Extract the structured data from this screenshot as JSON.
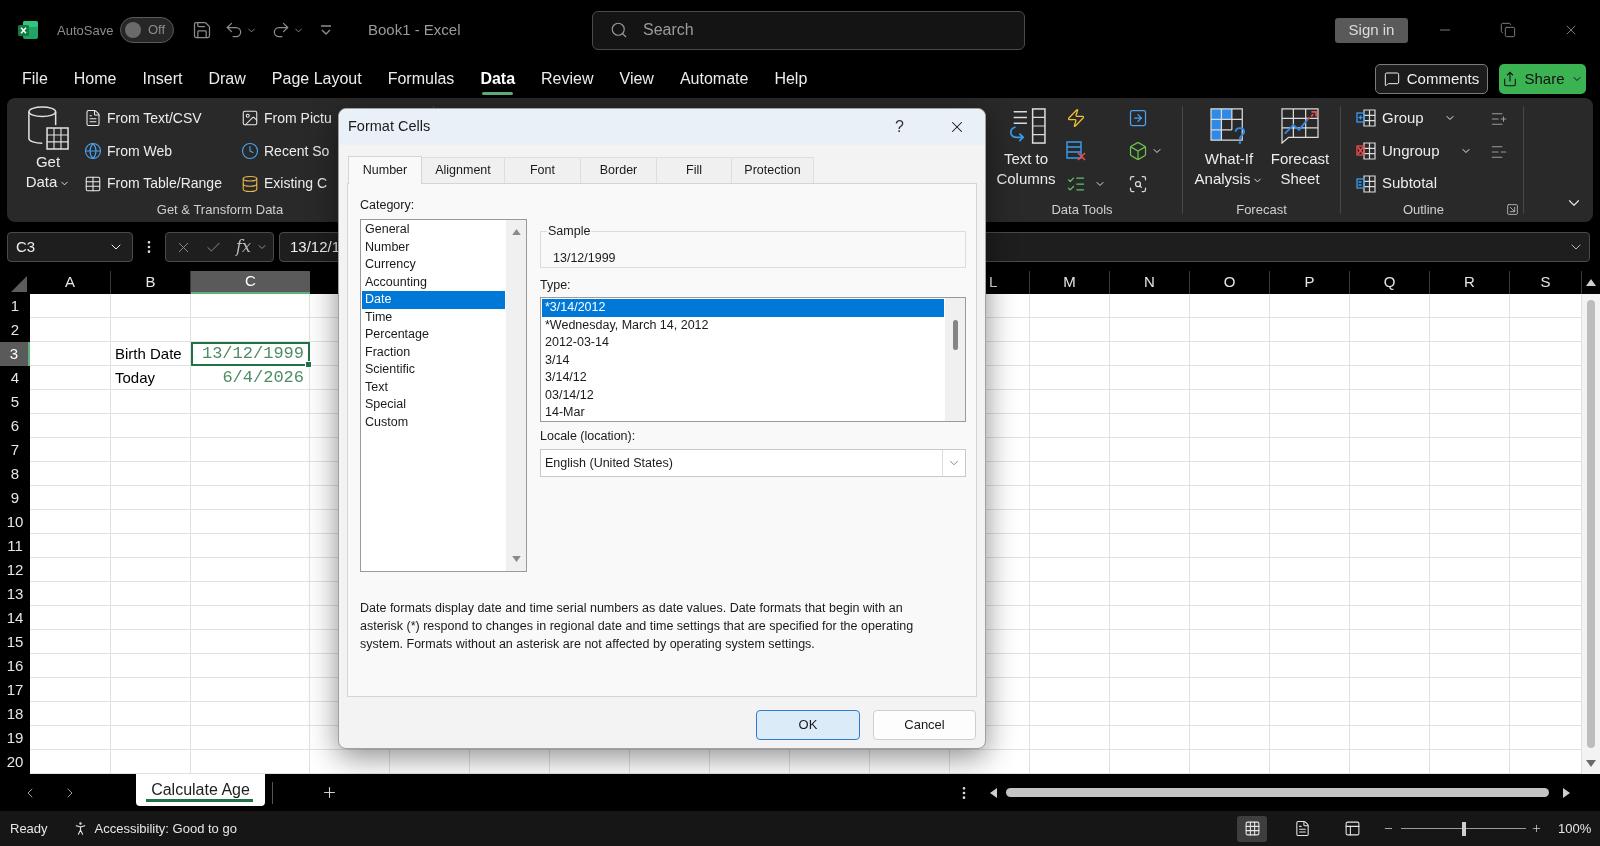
{
  "title_bar": {
    "autosave": "AutoSave",
    "autosave_toggle": {
      "label": "Off",
      "on": false
    },
    "document": "Book1 - Excel",
    "search": {
      "placeholder": "Search"
    },
    "sign_in": "Sign in"
  },
  "menu": {
    "tabs": [
      {
        "label": "File",
        "selected": false
      },
      {
        "label": "Home",
        "selected": false
      },
      {
        "label": "Insert",
        "selected": false
      },
      {
        "label": "Draw",
        "selected": false
      },
      {
        "label": "Page Layout",
        "selected": false
      },
      {
        "label": "Formulas",
        "selected": false
      },
      {
        "label": "Data",
        "selected": true
      },
      {
        "label": "Review",
        "selected": false
      },
      {
        "label": "View",
        "selected": false
      },
      {
        "label": "Automate",
        "selected": false
      },
      {
        "label": "Help",
        "selected": false
      }
    ],
    "comments": "Comments",
    "share": "Share"
  },
  "ribbon": {
    "get_transform": {
      "label": "Get & Transform Data",
      "get_data": "Get Data",
      "sources": [
        "From Text/CSV",
        "From Web",
        "From Table/Range"
      ],
      "more_sources": [
        "From Pictu",
        "Recent So",
        "Existing C"
      ]
    },
    "data_tools": {
      "label": "Data Tools",
      "text_to_columns": "Text to Columns"
    },
    "forecast": {
      "label": "Forecast",
      "what_if": "What-If Analysis",
      "forecast_sheet": "Forecast Sheet"
    },
    "outline": {
      "label": "Outline",
      "items": [
        "Group",
        "Ungroup",
        "Subtotal"
      ]
    }
  },
  "formula_bar": {
    "name_box": "C3",
    "function": "fx",
    "value": "13/12/1"
  },
  "sheet": {
    "columns": [
      {
        "label": "A",
        "selected": false
      },
      {
        "label": "B",
        "selected": false
      },
      {
        "label": "C",
        "selected": true
      },
      {
        "label": "L",
        "selected": false
      },
      {
        "label": "M",
        "selected": false
      },
      {
        "label": "N",
        "selected": false
      },
      {
        "label": "O",
        "selected": false
      },
      {
        "label": "P",
        "selected": false
      },
      {
        "label": "Q",
        "selected": false
      },
      {
        "label": "R",
        "selected": false
      },
      {
        "label": "S",
        "selected": false
      }
    ],
    "rows": [
      {
        "label": "1",
        "selected": false
      },
      {
        "label": "2",
        "selected": false
      },
      {
        "label": "3",
        "selected": true,
        "column_b": "Birth Date",
        "column_c": {
          "value": "13/12/1999",
          "selected": true
        }
      },
      {
        "label": "4",
        "selected": false,
        "column_b": "Today",
        "column_c": {
          "value": "6/4/2026",
          "selected": false
        }
      },
      {
        "label": "5",
        "selected": false
      },
      {
        "label": "6",
        "selected": false
      },
      {
        "label": "7",
        "selected": false
      },
      {
        "label": "8",
        "selected": false
      },
      {
        "label": "9",
        "selected": false
      },
      {
        "label": "10",
        "selected": false
      },
      {
        "label": "11",
        "selected": false
      },
      {
        "label": "12",
        "selected": false
      },
      {
        "label": "13",
        "selected": false
      },
      {
        "label": "14",
        "selected": false
      },
      {
        "label": "15",
        "selected": false
      },
      {
        "label": "16",
        "selected": false
      },
      {
        "label": "17",
        "selected": false
      },
      {
        "label": "18",
        "selected": false
      },
      {
        "label": "19",
        "selected": false
      },
      {
        "label": "20",
        "selected": false
      }
    ]
  },
  "sheet_tabs": [
    {
      "label": "Calculate Age",
      "selected": true
    }
  ],
  "status_bar": {
    "mode": "Ready",
    "accessibility": "Accessibility: Good to go",
    "views": [
      {
        "kind": "normal",
        "selected": true
      },
      {
        "kind": "page_layout",
        "selected": false
      },
      {
        "kind": "page_break",
        "selected": false
      }
    ],
    "zoom": {
      "level": 0.5,
      "reading": "100%"
    }
  },
  "dialog": {
    "title": "Format Cells",
    "help": "?",
    "tabs": [
      {
        "label": "Number",
        "selected": true
      },
      {
        "label": "Alignment",
        "selected": false
      },
      {
        "label": "Font",
        "selected": false
      },
      {
        "label": "Border",
        "selected": false
      },
      {
        "label": "Fill",
        "selected": false
      },
      {
        "label": "Protection",
        "selected": false
      }
    ],
    "category": {
      "label": "Category:",
      "items": [
        {
          "label": "General",
          "selected": false
        },
        {
          "label": "Number",
          "selected": false
        },
        {
          "label": "Currency",
          "selected": false
        },
        {
          "label": "Accounting",
          "selected": false
        },
        {
          "label": "Date",
          "selected": true
        },
        {
          "label": "Time",
          "selected": false
        },
        {
          "label": "Percentage",
          "selected": false
        },
        {
          "label": "Fraction",
          "selected": false
        },
        {
          "label": "Scientific",
          "selected": false
        },
        {
          "label": "Text",
          "selected": false
        },
        {
          "label": "Special",
          "selected": false
        },
        {
          "label": "Custom",
          "selected": false
        }
      ]
    },
    "sample": {
      "label": "Sample",
      "value": "13/12/1999"
    },
    "type": {
      "label": "Type:",
      "items": [
        {
          "label": "*3/14/2012",
          "selected": true
        },
        {
          "label": "*Wednesday, March 14, 2012",
          "selected": false
        },
        {
          "label": "2012-03-14",
          "selected": false
        },
        {
          "label": "3/14",
          "selected": false
        },
        {
          "label": "3/14/12",
          "selected": false
        },
        {
          "label": "03/14/12",
          "selected": false
        },
        {
          "label": "14-Mar",
          "selected": false
        }
      ]
    },
    "locale": {
      "label": "Locale (location):",
      "value": "English (United States)"
    },
    "description": "Date formats display date and time serial numbers as date values. Date formats that begin with an asterisk (*) respond to changes in regional date and time settings that are specified for the operating system. Formats without an asterisk are not affected by operating system settings.",
    "buttons": [
      {
        "label": "OK",
        "kind": "default"
      },
      {
        "label": "Cancel",
        "kind": "normal"
      }
    ]
  }
}
